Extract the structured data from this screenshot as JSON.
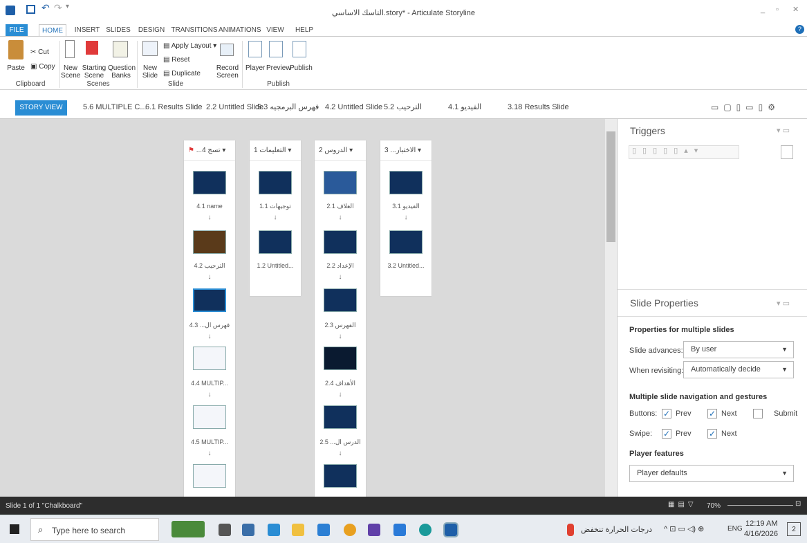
{
  "window": {
    "title": "التاسك الاساسي.story* - Articulate Storyline",
    "controls": [
      "_",
      "🗗",
      "X"
    ]
  },
  "ribbon_tabs": [
    "FILE",
    "HOME",
    "INSERT",
    "SLIDES",
    "DESIGN",
    "TRANSITIONS",
    "ANIMATIONS",
    "VIEW",
    "HELP"
  ],
  "ribbon": {
    "paste": "Paste",
    "cut": "Cut",
    "copy": "Copy",
    "new_scene": [
      "New",
      "Scene"
    ],
    "starting_scene": [
      "Starting",
      "Scene"
    ],
    "question_banks": [
      "Question",
      "Banks"
    ],
    "new_slide": [
      "New",
      "Slide"
    ],
    "apply_layout": "Apply Layout",
    "reset": "Reset",
    "duplicate": "Duplicate",
    "record_screen": [
      "Record",
      "Screen"
    ],
    "player": "Player",
    "preview": "Preview",
    "publish": "Publish",
    "groups": {
      "clipboard": "Clipboard",
      "scenes": "Scenes",
      "slide": "Slide",
      "publish": "Publish"
    }
  },
  "story_tabs": [
    "STORY VIEW",
    "5.6 MULTIPLE C...",
    "6.1 Results Slide",
    "2.2 Untitled Slide",
    "5.3 فهرس البرمجيه",
    "4.2 Untitled Slide",
    "5.2 الترحيب",
    "4.1 الفيديو",
    "3.18 Results Slide"
  ],
  "scenes": [
    {
      "header": "...تسج 4",
      "slides": [
        "4.1 name",
        "4.2 الترحيب",
        "4.3 ...فهرس ال",
        "4.4 MULTIP...",
        "4.5 MULTIP..."
      ]
    },
    {
      "header": "1 التعليمات",
      "slides": [
        "1.1 توجيهات",
        "1.2 Untitled..."
      ]
    },
    {
      "header": "2 الدروس",
      "slides": [
        "2.1 الغلاف",
        "2.2 الإعداد",
        "2.3 الفهرس",
        "2.4 الأهداف",
        "2.5 ...الدرس ال"
      ]
    },
    {
      "header": "3 ...الاختبار",
      "slides": [
        "3.1 الفيديو",
        "3.2 Untitled..."
      ]
    }
  ],
  "triggers": {
    "title": "Triggers"
  },
  "slide_properties": {
    "title": "Slide Properties",
    "subtitle": "Properties for multiple slides",
    "slide_advances_label": "Slide advances:",
    "slide_advances_value": "By user",
    "when_revisiting_label": "When revisiting:",
    "when_revisiting_value": "Automatically decide",
    "nav_title": "Multiple slide navigation and gestures",
    "buttons_label": "Buttons:",
    "swipe_label": "Swipe:",
    "prev": "Prev",
    "next": "Next",
    "submit": "Submit",
    "buttons_prev": true,
    "buttons_next": true,
    "buttons_submit": false,
    "swipe_prev": true,
    "swipe_next": true,
    "player_features": "Player features",
    "player_value": "Player defaults"
  },
  "status": {
    "left": "Slide 1 of 1   \"Chalkboard\"",
    "zoom": "70%"
  },
  "taskbar": {
    "search_placeholder": "Type here to search",
    "weather": "درجات الحرارة تنخفض",
    "lang": "ENG",
    "time": "12:19 AM",
    "date": "4/16/2026",
    "notif": "2"
  },
  "colors": {
    "accent": "#2a8dd4",
    "canvas": "#dadada",
    "status_bar": "#2d2d2d",
    "slide_thumb": "#10305c"
  }
}
